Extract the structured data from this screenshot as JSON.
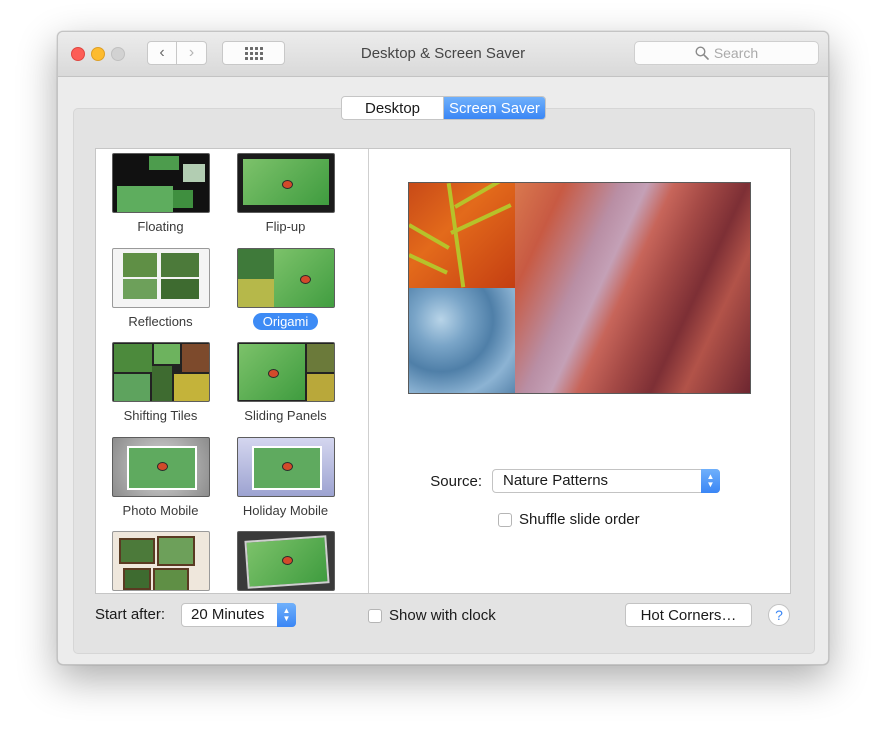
{
  "window": {
    "title": "Desktop & Screen Saver"
  },
  "toolbar": {
    "back_icon": "chevron-left-icon",
    "forward_icon": "chevron-right-icon",
    "grid_icon": "grid-icon"
  },
  "search": {
    "placeholder": "Search",
    "icon": "search-icon"
  },
  "tabs": {
    "desktop": "Desktop",
    "screen_saver": "Screen Saver",
    "selected": "Screen Saver"
  },
  "screen_savers": [
    {
      "label": "Floating"
    },
    {
      "label": "Flip-up"
    },
    {
      "label": "Reflections"
    },
    {
      "label": "Origami",
      "selected": true
    },
    {
      "label": "Shifting Tiles"
    },
    {
      "label": "Sliding Panels"
    },
    {
      "label": "Photo Mobile"
    },
    {
      "label": "Holiday Mobile"
    },
    {
      "label": ""
    },
    {
      "label": ""
    }
  ],
  "options": {
    "source_label": "Source:",
    "source_value": "Nature Patterns",
    "shuffle_label": "Shuffle slide order",
    "shuffle_checked": false
  },
  "bottom": {
    "start_after_label": "Start after:",
    "start_after_value": "20 Minutes",
    "show_clock_label": "Show with clock",
    "show_clock_checked": false,
    "hot_corners_label": "Hot Corners…",
    "help_label": "?"
  },
  "colors": {
    "accent": "#3a86f5",
    "selected_label": "#3d8bf5"
  }
}
